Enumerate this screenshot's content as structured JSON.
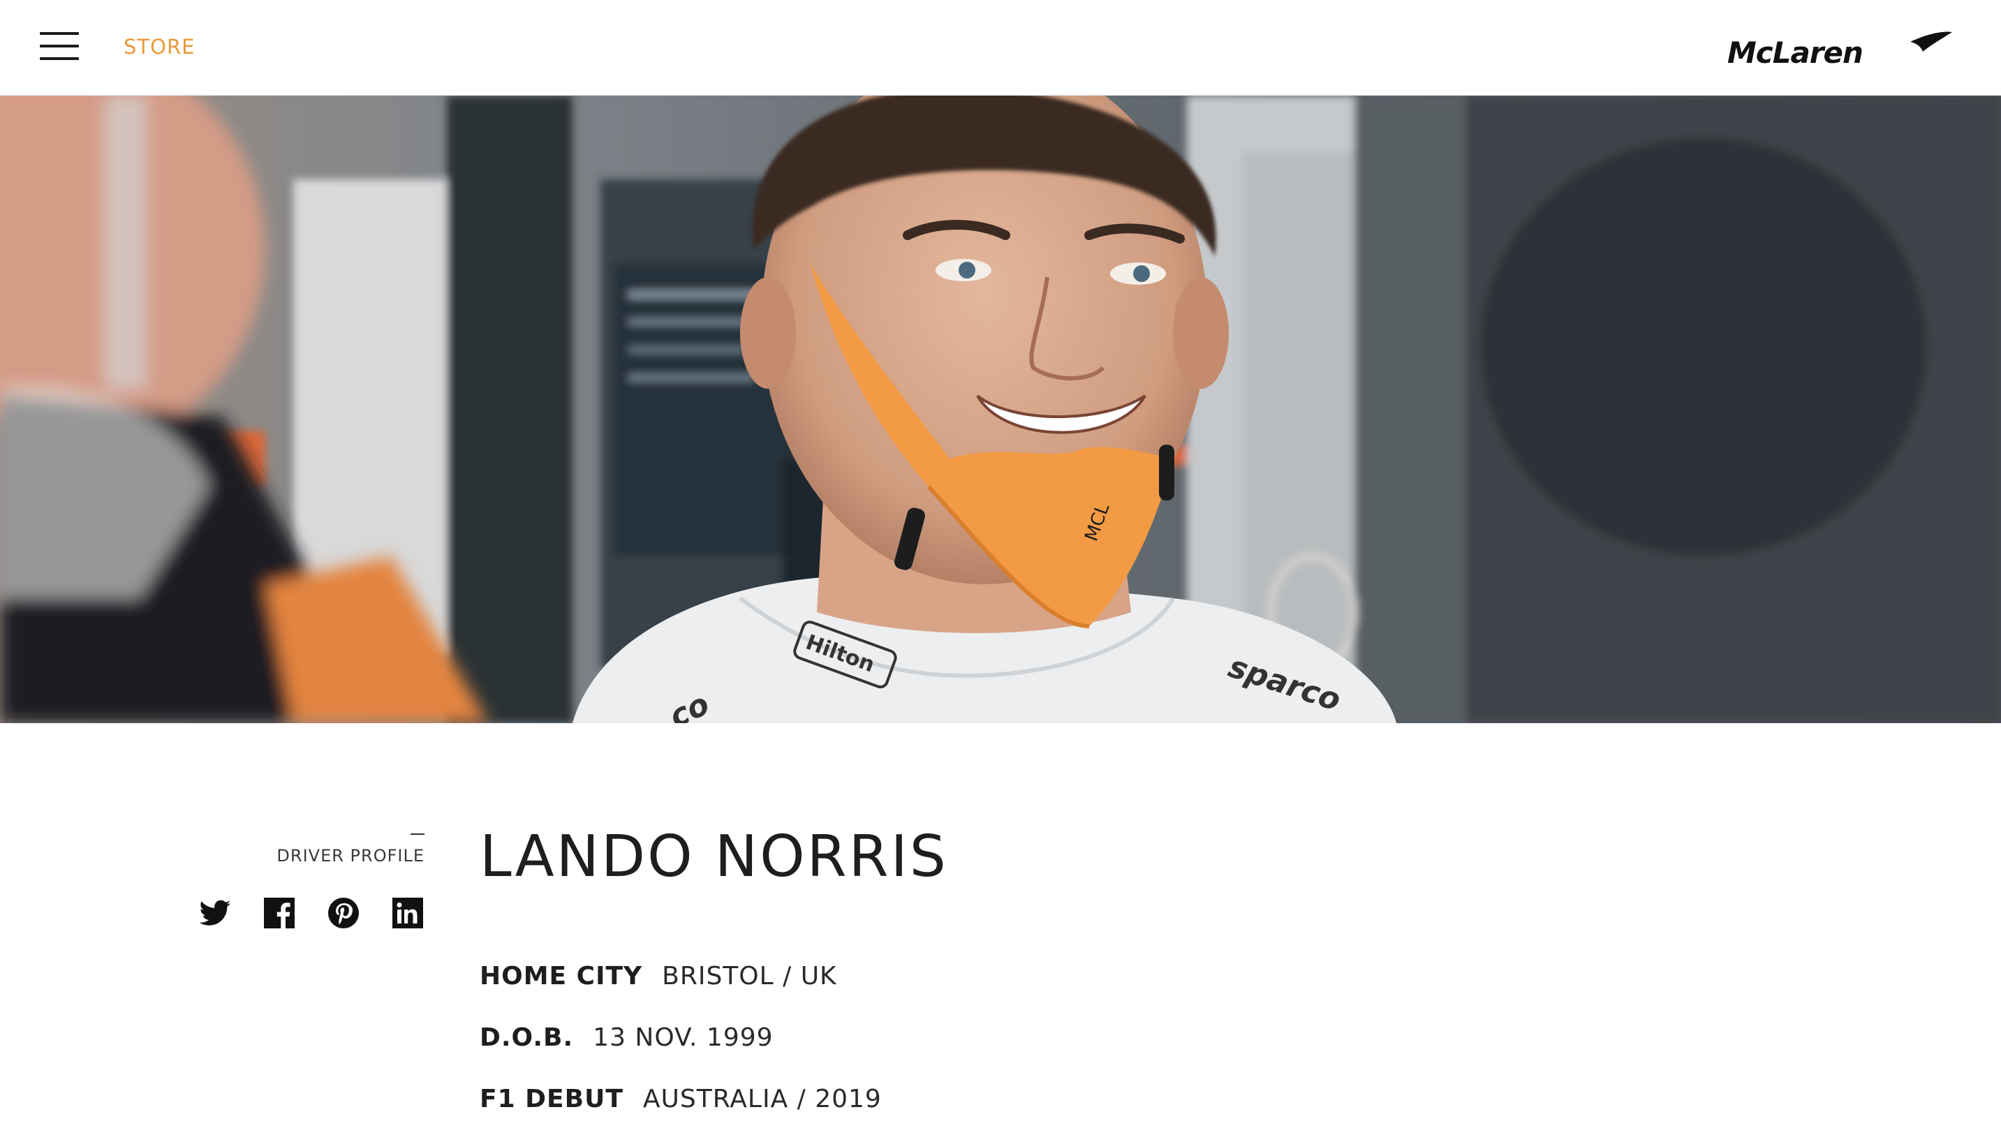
{
  "header": {
    "menu_icon": "hamburger-menu-icon",
    "store_label": "STORE",
    "logo_text": "McLaren",
    "accent_color": "#e89a3c"
  },
  "hero": {
    "image_alt": "driver-portrait-photo"
  },
  "profile": {
    "section_label": "DRIVER PROFILE",
    "socials": [
      {
        "icon": "twitter-icon"
      },
      {
        "icon": "facebook-icon"
      },
      {
        "icon": "pinterest-icon"
      },
      {
        "icon": "linkedin-icon"
      }
    ],
    "name": "LANDO NORRIS",
    "stats": [
      {
        "label": "HOME CITY",
        "value": "BRISTOL / UK"
      },
      {
        "label": "D.O.B.",
        "value": "13 NOV. 1999"
      },
      {
        "label": "F1 DEBUT",
        "value": "AUSTRALIA / 2019"
      }
    ]
  }
}
